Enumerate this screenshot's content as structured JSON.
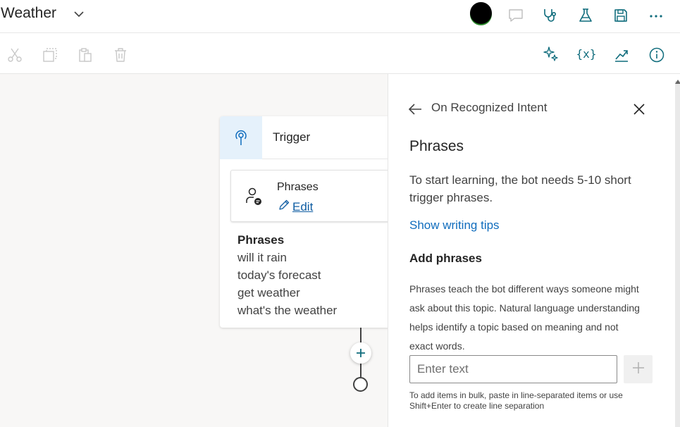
{
  "header": {
    "title": "Weather",
    "icons": [
      "chevron-down-icon",
      "avatar",
      "chat-icon",
      "stethoscope-icon",
      "flask-icon",
      "save-icon",
      "more-icon"
    ]
  },
  "toolbar": {
    "icons": [
      "cut-icon",
      "copy-icon",
      "paste-icon",
      "delete-icon",
      "sparkle-icon",
      "variable-icon",
      "analytics-icon",
      "info-icon"
    ],
    "variable_label": "{x}"
  },
  "canvas": {
    "trigger_title": "Trigger",
    "phrases_card_title": "Phrases",
    "edit_label": "Edit",
    "phrases_list_title": "Phrases",
    "phrases": [
      "will it rain",
      "today's forecast",
      "get weather",
      "what's the weather"
    ]
  },
  "panel": {
    "header": "On Recognized Intent",
    "title": "Phrases",
    "description": "To start learning, the bot needs 5-10 short trigger phrases.",
    "tips_link": "Show writing tips",
    "add_phrases_title": "Add phrases",
    "help_text": "Phrases teach the bot different ways someone might ask about this topic. Natural language understanding helps identify a topic based on meaning and not exact words.",
    "input_placeholder": "Enter text",
    "input_value": "",
    "bulk_hint": "To add items in bulk, paste in line-separated items or use Shift+Enter to create line separation"
  },
  "colors": {
    "accent": "#0f6cbd",
    "link": "#115ea3",
    "trigger_bg": "#e5f1fb",
    "canvas_bg": "#f8f7f6",
    "avatar_ring": "#2e8b2e"
  }
}
